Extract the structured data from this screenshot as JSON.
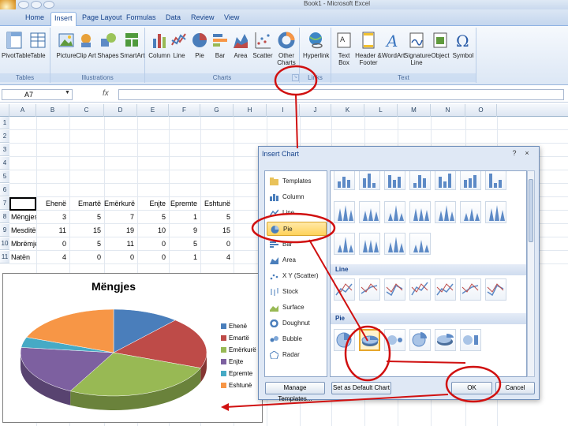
{
  "window": {
    "title": "Book1 - Microsoft Excel"
  },
  "tabs": [
    {
      "label": "Home",
      "active": false
    },
    {
      "label": "Insert",
      "active": true
    },
    {
      "label": "Page Layout",
      "active": false
    },
    {
      "label": "Formulas",
      "active": false
    },
    {
      "label": "Data",
      "active": false
    },
    {
      "label": "Review",
      "active": false
    },
    {
      "label": "View",
      "active": false
    }
  ],
  "ribbon": {
    "groups": {
      "tables": "Tables",
      "illustrations": "Illustrations",
      "charts": "Charts",
      "links": "Links",
      "text": "Text"
    },
    "buttons": {
      "pivottable": "PivotTable",
      "table": "Table",
      "picture": "Picture",
      "clipart": "Clip Art",
      "shapes": "Shapes",
      "smartart": "SmartArt",
      "column": "Column",
      "line": "Line",
      "pie": "Pie",
      "bar": "Bar",
      "area": "Area",
      "scatter": "Scatter",
      "other": "Other Charts",
      "hyperlink": "Hyperlink",
      "textbox": "Text Box",
      "header": "Header & Footer",
      "wordart": "WordArt",
      "signature": "Signature Line",
      "object": "Object",
      "symbol": "Symbol"
    }
  },
  "formula_bar": {
    "name_box": "A7",
    "fx": "fx",
    "value": ""
  },
  "sheet": {
    "columns": [
      "A",
      "B",
      "C",
      "D",
      "E",
      "F",
      "G",
      "H",
      "I",
      "J",
      "K",
      "L",
      "M",
      "N",
      "O"
    ],
    "rows": [
      "1",
      "2",
      "3",
      "4",
      "5",
      "6",
      "7",
      "8",
      "9",
      "10",
      "11"
    ],
    "header_row": [
      "",
      "Ehenë",
      "Emartë",
      "Emërkurë",
      "Enjte",
      "Epremte",
      "Eshtunë"
    ],
    "data_rows": [
      {
        "label": "Mëngjes",
        "values": [
          "3",
          "5",
          "7",
          "5",
          "1",
          "5"
        ]
      },
      {
        "label": "Mesditë",
        "values": [
          "11",
          "15",
          "19",
          "10",
          "9",
          "15"
        ]
      },
      {
        "label": "Mbrëmje",
        "values": [
          "0",
          "5",
          "11",
          "0",
          "5",
          "0"
        ]
      },
      {
        "label": "Natën",
        "values": [
          "4",
          "0",
          "0",
          "0",
          "1",
          "4"
        ]
      }
    ]
  },
  "chart_data": {
    "type": "pie",
    "title": "Mëngjes",
    "categories": [
      "Ehenë",
      "Emartë",
      "Emërkurë",
      "Enjte",
      "Epremte",
      "Eshtunë"
    ],
    "values": [
      3,
      5,
      7,
      5,
      1,
      5
    ],
    "colors": [
      "#4a7ebb",
      "#be4b48",
      "#98b954",
      "#7d60a0",
      "#46aac5",
      "#f79646"
    ],
    "legend": "right"
  },
  "dialog": {
    "title": "Insert Chart",
    "help": "?",
    "close": "×",
    "types": [
      {
        "label": "Templates",
        "icon": "folder-icon",
        "selected": false
      },
      {
        "label": "Column",
        "icon": "column-chart-icon",
        "selected": false
      },
      {
        "label": "Line",
        "icon": "line-chart-icon",
        "selected": false
      },
      {
        "label": "Pie",
        "icon": "pie-chart-icon",
        "selected": true
      },
      {
        "label": "Bar",
        "icon": "bar-chart-icon",
        "selected": false
      },
      {
        "label": "Area",
        "icon": "area-chart-icon",
        "selected": false
      },
      {
        "label": "X Y (Scatter)",
        "icon": "scatter-chart-icon",
        "selected": false
      },
      {
        "label": "Stock",
        "icon": "stock-chart-icon",
        "selected": false
      },
      {
        "label": "Surface",
        "icon": "surface-chart-icon",
        "selected": false
      },
      {
        "label": "Doughnut",
        "icon": "doughnut-chart-icon",
        "selected": false
      },
      {
        "label": "Bubble",
        "icon": "bubble-chart-icon",
        "selected": false
      },
      {
        "label": "Radar",
        "icon": "radar-chart-icon",
        "selected": false
      }
    ],
    "sections": {
      "line": "Line",
      "pie": "Pie"
    },
    "buttons": {
      "manage": "Manage Templates...",
      "default": "Set as Default Chart",
      "ok": "OK",
      "cancel": "Cancel"
    }
  },
  "annotation_color": "#d01010"
}
